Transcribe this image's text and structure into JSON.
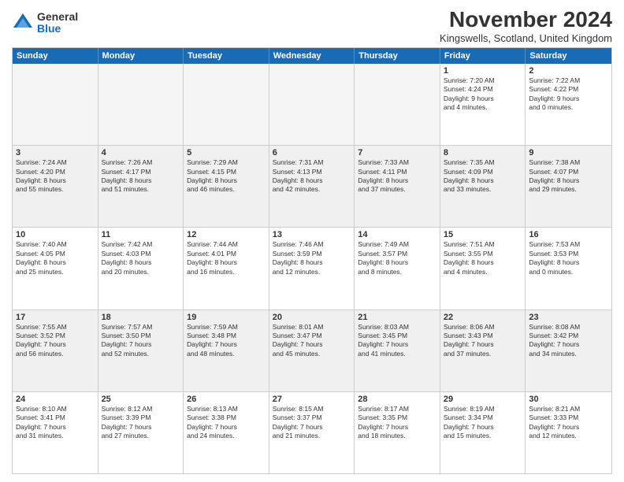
{
  "logo": {
    "general": "General",
    "blue": "Blue"
  },
  "title": "November 2024",
  "subtitle": "Kingswells, Scotland, United Kingdom",
  "headers": [
    "Sunday",
    "Monday",
    "Tuesday",
    "Wednesday",
    "Thursday",
    "Friday",
    "Saturday"
  ],
  "rows": [
    [
      {
        "day": "",
        "info": "",
        "empty": true
      },
      {
        "day": "",
        "info": "",
        "empty": true
      },
      {
        "day": "",
        "info": "",
        "empty": true
      },
      {
        "day": "",
        "info": "",
        "empty": true
      },
      {
        "day": "",
        "info": "",
        "empty": true
      },
      {
        "day": "1",
        "info": "Sunrise: 7:20 AM\nSunset: 4:24 PM\nDaylight: 9 hours\nand 4 minutes.",
        "empty": false
      },
      {
        "day": "2",
        "info": "Sunrise: 7:22 AM\nSunset: 4:22 PM\nDaylight: 9 hours\nand 0 minutes.",
        "empty": false
      }
    ],
    [
      {
        "day": "3",
        "info": "Sunrise: 7:24 AM\nSunset: 4:20 PM\nDaylight: 8 hours\nand 55 minutes.",
        "empty": false
      },
      {
        "day": "4",
        "info": "Sunrise: 7:26 AM\nSunset: 4:17 PM\nDaylight: 8 hours\nand 51 minutes.",
        "empty": false
      },
      {
        "day": "5",
        "info": "Sunrise: 7:29 AM\nSunset: 4:15 PM\nDaylight: 8 hours\nand 46 minutes.",
        "empty": false
      },
      {
        "day": "6",
        "info": "Sunrise: 7:31 AM\nSunset: 4:13 PM\nDaylight: 8 hours\nand 42 minutes.",
        "empty": false
      },
      {
        "day": "7",
        "info": "Sunrise: 7:33 AM\nSunset: 4:11 PM\nDaylight: 8 hours\nand 37 minutes.",
        "empty": false
      },
      {
        "day": "8",
        "info": "Sunrise: 7:35 AM\nSunset: 4:09 PM\nDaylight: 8 hours\nand 33 minutes.",
        "empty": false
      },
      {
        "day": "9",
        "info": "Sunrise: 7:38 AM\nSunset: 4:07 PM\nDaylight: 8 hours\nand 29 minutes.",
        "empty": false
      }
    ],
    [
      {
        "day": "10",
        "info": "Sunrise: 7:40 AM\nSunset: 4:05 PM\nDaylight: 8 hours\nand 25 minutes.",
        "empty": false
      },
      {
        "day": "11",
        "info": "Sunrise: 7:42 AM\nSunset: 4:03 PM\nDaylight: 8 hours\nand 20 minutes.",
        "empty": false
      },
      {
        "day": "12",
        "info": "Sunrise: 7:44 AM\nSunset: 4:01 PM\nDaylight: 8 hours\nand 16 minutes.",
        "empty": false
      },
      {
        "day": "13",
        "info": "Sunrise: 7:46 AM\nSunset: 3:59 PM\nDaylight: 8 hours\nand 12 minutes.",
        "empty": false
      },
      {
        "day": "14",
        "info": "Sunrise: 7:49 AM\nSunset: 3:57 PM\nDaylight: 8 hours\nand 8 minutes.",
        "empty": false
      },
      {
        "day": "15",
        "info": "Sunrise: 7:51 AM\nSunset: 3:55 PM\nDaylight: 8 hours\nand 4 minutes.",
        "empty": false
      },
      {
        "day": "16",
        "info": "Sunrise: 7:53 AM\nSunset: 3:53 PM\nDaylight: 8 hours\nand 0 minutes.",
        "empty": false
      }
    ],
    [
      {
        "day": "17",
        "info": "Sunrise: 7:55 AM\nSunset: 3:52 PM\nDaylight: 7 hours\nand 56 minutes.",
        "empty": false
      },
      {
        "day": "18",
        "info": "Sunrise: 7:57 AM\nSunset: 3:50 PM\nDaylight: 7 hours\nand 52 minutes.",
        "empty": false
      },
      {
        "day": "19",
        "info": "Sunrise: 7:59 AM\nSunset: 3:48 PM\nDaylight: 7 hours\nand 48 minutes.",
        "empty": false
      },
      {
        "day": "20",
        "info": "Sunrise: 8:01 AM\nSunset: 3:47 PM\nDaylight: 7 hours\nand 45 minutes.",
        "empty": false
      },
      {
        "day": "21",
        "info": "Sunrise: 8:03 AM\nSunset: 3:45 PM\nDaylight: 7 hours\nand 41 minutes.",
        "empty": false
      },
      {
        "day": "22",
        "info": "Sunrise: 8:06 AM\nSunset: 3:43 PM\nDaylight: 7 hours\nand 37 minutes.",
        "empty": false
      },
      {
        "day": "23",
        "info": "Sunrise: 8:08 AM\nSunset: 3:42 PM\nDaylight: 7 hours\nand 34 minutes.",
        "empty": false
      }
    ],
    [
      {
        "day": "24",
        "info": "Sunrise: 8:10 AM\nSunset: 3:41 PM\nDaylight: 7 hours\nand 31 minutes.",
        "empty": false
      },
      {
        "day": "25",
        "info": "Sunrise: 8:12 AM\nSunset: 3:39 PM\nDaylight: 7 hours\nand 27 minutes.",
        "empty": false
      },
      {
        "day": "26",
        "info": "Sunrise: 8:13 AM\nSunset: 3:38 PM\nDaylight: 7 hours\nand 24 minutes.",
        "empty": false
      },
      {
        "day": "27",
        "info": "Sunrise: 8:15 AM\nSunset: 3:37 PM\nDaylight: 7 hours\nand 21 minutes.",
        "empty": false
      },
      {
        "day": "28",
        "info": "Sunrise: 8:17 AM\nSunset: 3:35 PM\nDaylight: 7 hours\nand 18 minutes.",
        "empty": false
      },
      {
        "day": "29",
        "info": "Sunrise: 8:19 AM\nSunset: 3:34 PM\nDaylight: 7 hours\nand 15 minutes.",
        "empty": false
      },
      {
        "day": "30",
        "info": "Sunrise: 8:21 AM\nSunset: 3:33 PM\nDaylight: 7 hours\nand 12 minutes.",
        "empty": false
      }
    ]
  ]
}
